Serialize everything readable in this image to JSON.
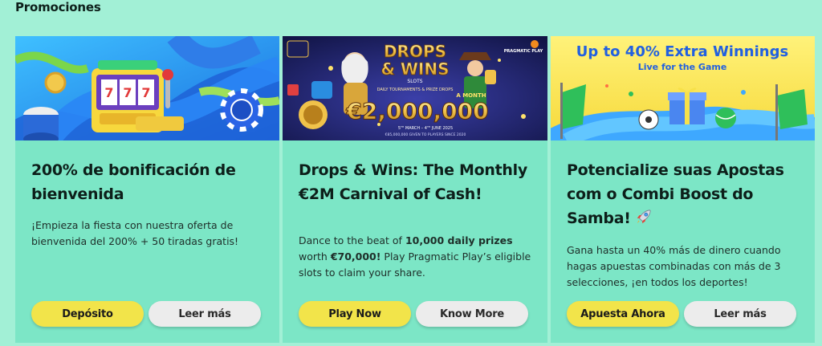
{
  "section_title": "Promociones",
  "cards": [
    {
      "title": "200% de bonificación de bienvenida",
      "description": "¡Empieza la fiesta con nuestra oferta de bienvenida del 200% + 50 tiradas gratis!",
      "primary_button": "Depósito",
      "secondary_button": "Leer más",
      "banner_icons": [
        "slot-machine",
        "casino-chip",
        "drum"
      ]
    },
    {
      "title": "Drops & Wins: The Monthly €2M Carnival of Cash!",
      "description": {
        "part1": "Dance to the beat of ",
        "bold1": "10,000 daily prizes",
        "part2": " worth ",
        "bold2": "€70,000!",
        "part3": " Play Pragmatic Play’s eligible slots to claim your share."
      },
      "primary_button": "Play Now",
      "secondary_button": "Know More",
      "banner": {
        "logo_line1": "DROPS",
        "logo_line2": "& WINS",
        "logo_sub": "SLOTS",
        "tagline": "DAILY TOURNAMENTS & PRIZE DROPS",
        "amount": "€2,000,000",
        "period": "A MONTH",
        "dates": "5ᵀᴴ MARCH – 4ᵀᴴ JUNE 2025",
        "footer": "€85,000,000 GIVEN TO PLAYERS SINCE 2020",
        "badge": "PRAGMATIC PLAY"
      }
    },
    {
      "title": "Potencialize suas Apostas com o Combi Boost do Samba!",
      "description": "Gana hasta un 40% más de dinero cuando hagas apuestas combinadas con más de 3 selecciones, ¡en todos los deportes!",
      "primary_button": "Apuesta Ahora",
      "secondary_button": "Leer más",
      "banner": {
        "headline": "Up to 40% Extra Winnings",
        "subline": "Live for the Game"
      },
      "title_icon": "rocket-icon"
    }
  ],
  "colors": {
    "page_bg": "#a2f0d6",
    "card_bg": "#7ce6c6",
    "primary_button": "#f2e44a",
    "secondary_button": "#ececec"
  }
}
